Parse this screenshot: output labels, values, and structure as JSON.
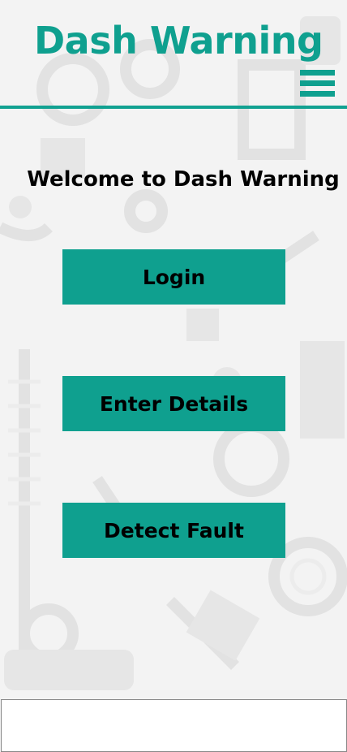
{
  "header": {
    "title": "Dash Warning",
    "menu_icon": "hamburger-menu-icon"
  },
  "main": {
    "welcome_text": "Welcome to Dash Warning",
    "buttons": [
      {
        "label": "Login"
      },
      {
        "label": "Enter Details"
      },
      {
        "label": "Detect Fault"
      }
    ]
  },
  "colors": {
    "accent": "#0fa08f",
    "background": "#f3f3f3"
  }
}
